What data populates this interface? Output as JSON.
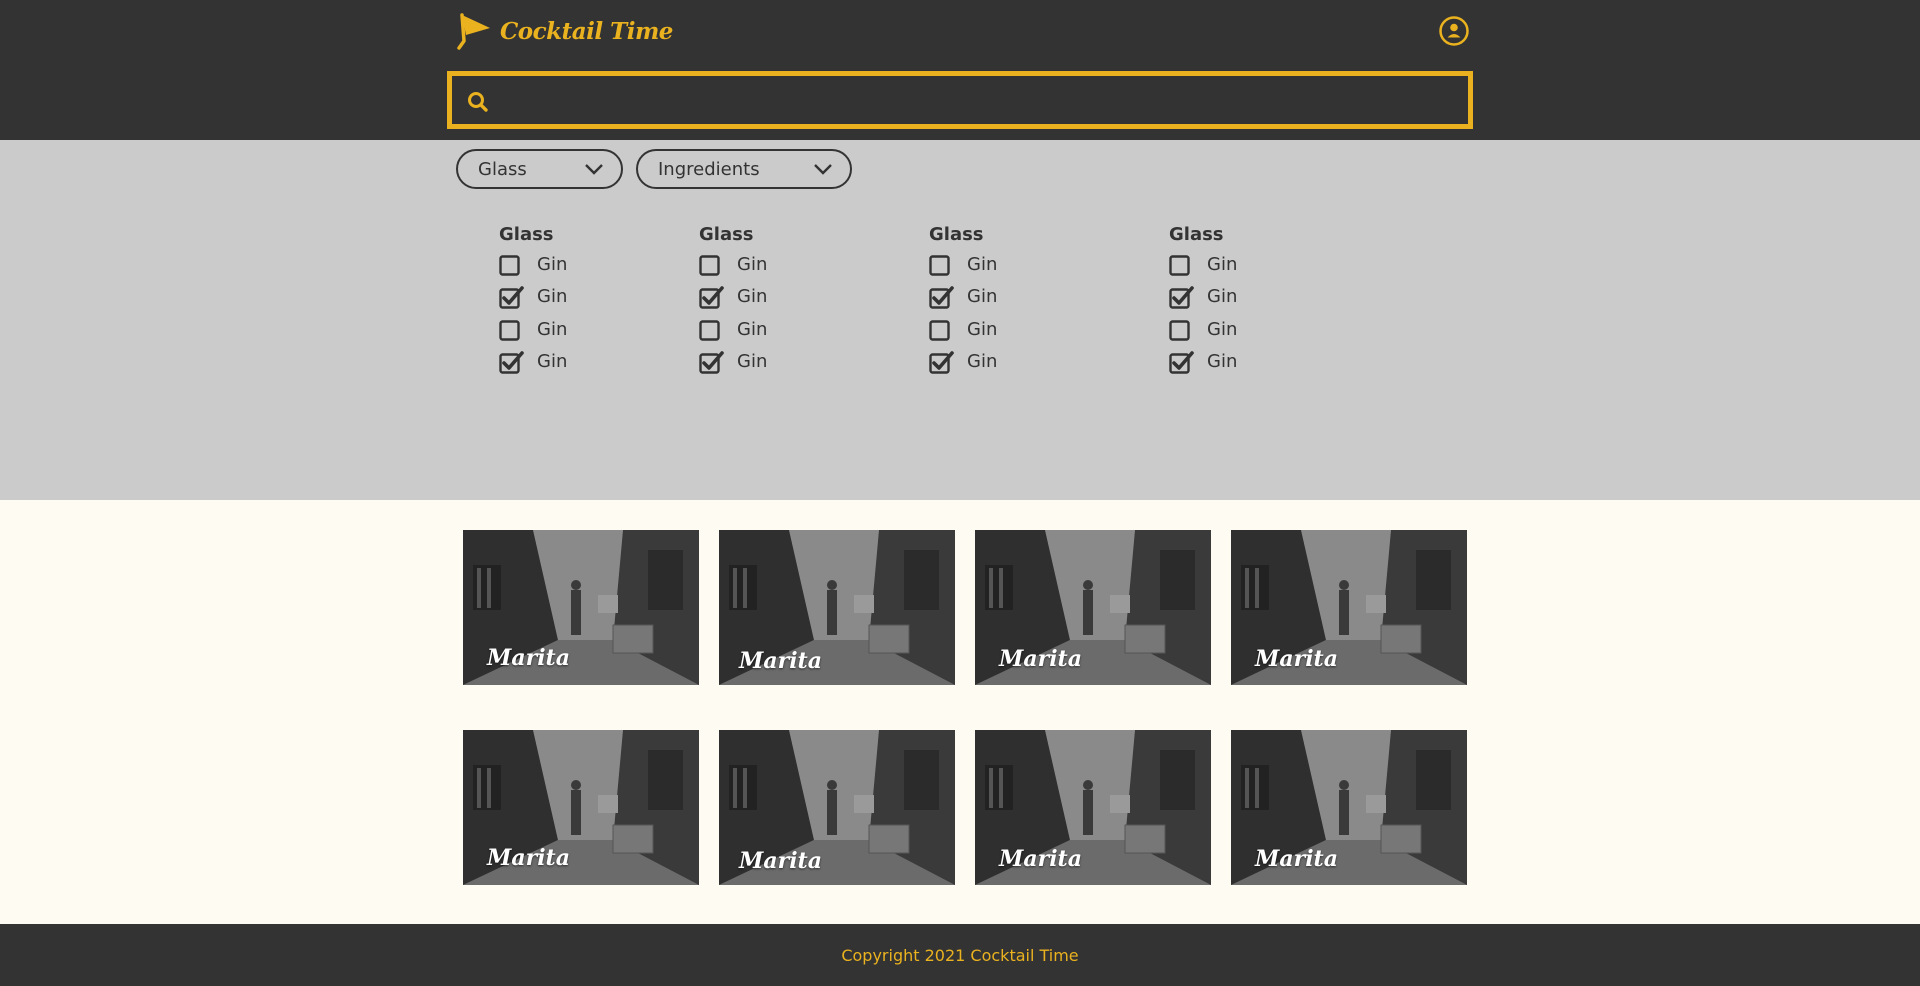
{
  "header": {
    "logo_text": "Cocktail Time",
    "accent_color": "#eab21f",
    "background_color": "#333333",
    "profile_icon": "user-circle-icon",
    "search": {
      "icon": "search-icon",
      "value": "",
      "placeholder": ""
    }
  },
  "filters": {
    "dropdowns": [
      {
        "label": "Glass",
        "icon": "chevron-down-icon"
      },
      {
        "label": "Ingredients",
        "icon": "chevron-down-icon"
      }
    ],
    "columns": [
      {
        "title": "Glass",
        "options": [
          {
            "label": "Gin",
            "checked": false
          },
          {
            "label": "Gin",
            "checked": true
          },
          {
            "label": "Gin",
            "checked": false
          },
          {
            "label": "Gin",
            "checked": true
          }
        ]
      },
      {
        "title": "Glass",
        "options": [
          {
            "label": "Gin",
            "checked": false
          },
          {
            "label": "Gin",
            "checked": true
          },
          {
            "label": "Gin",
            "checked": false
          },
          {
            "label": "Gin",
            "checked": true
          }
        ]
      },
      {
        "title": "Glass",
        "options": [
          {
            "label": "Gin",
            "checked": false
          },
          {
            "label": "Gin",
            "checked": true
          },
          {
            "label": "Gin",
            "checked": false
          },
          {
            "label": "Gin",
            "checked": true
          }
        ]
      },
      {
        "title": "Glass",
        "options": [
          {
            "label": "Gin",
            "checked": false
          },
          {
            "label": "Gin",
            "checked": true
          },
          {
            "label": "Gin",
            "checked": false
          },
          {
            "label": "Gin",
            "checked": true
          }
        ]
      }
    ]
  },
  "results": [
    {
      "name": "Marita"
    },
    {
      "name": "Marita"
    },
    {
      "name": "Marita"
    },
    {
      "name": "Marita"
    },
    {
      "name": "Marita"
    },
    {
      "name": "Marita"
    },
    {
      "name": "Marita"
    },
    {
      "name": "Marita"
    }
  ],
  "footer": {
    "text": "Copyright 2021 Cocktail Time"
  }
}
